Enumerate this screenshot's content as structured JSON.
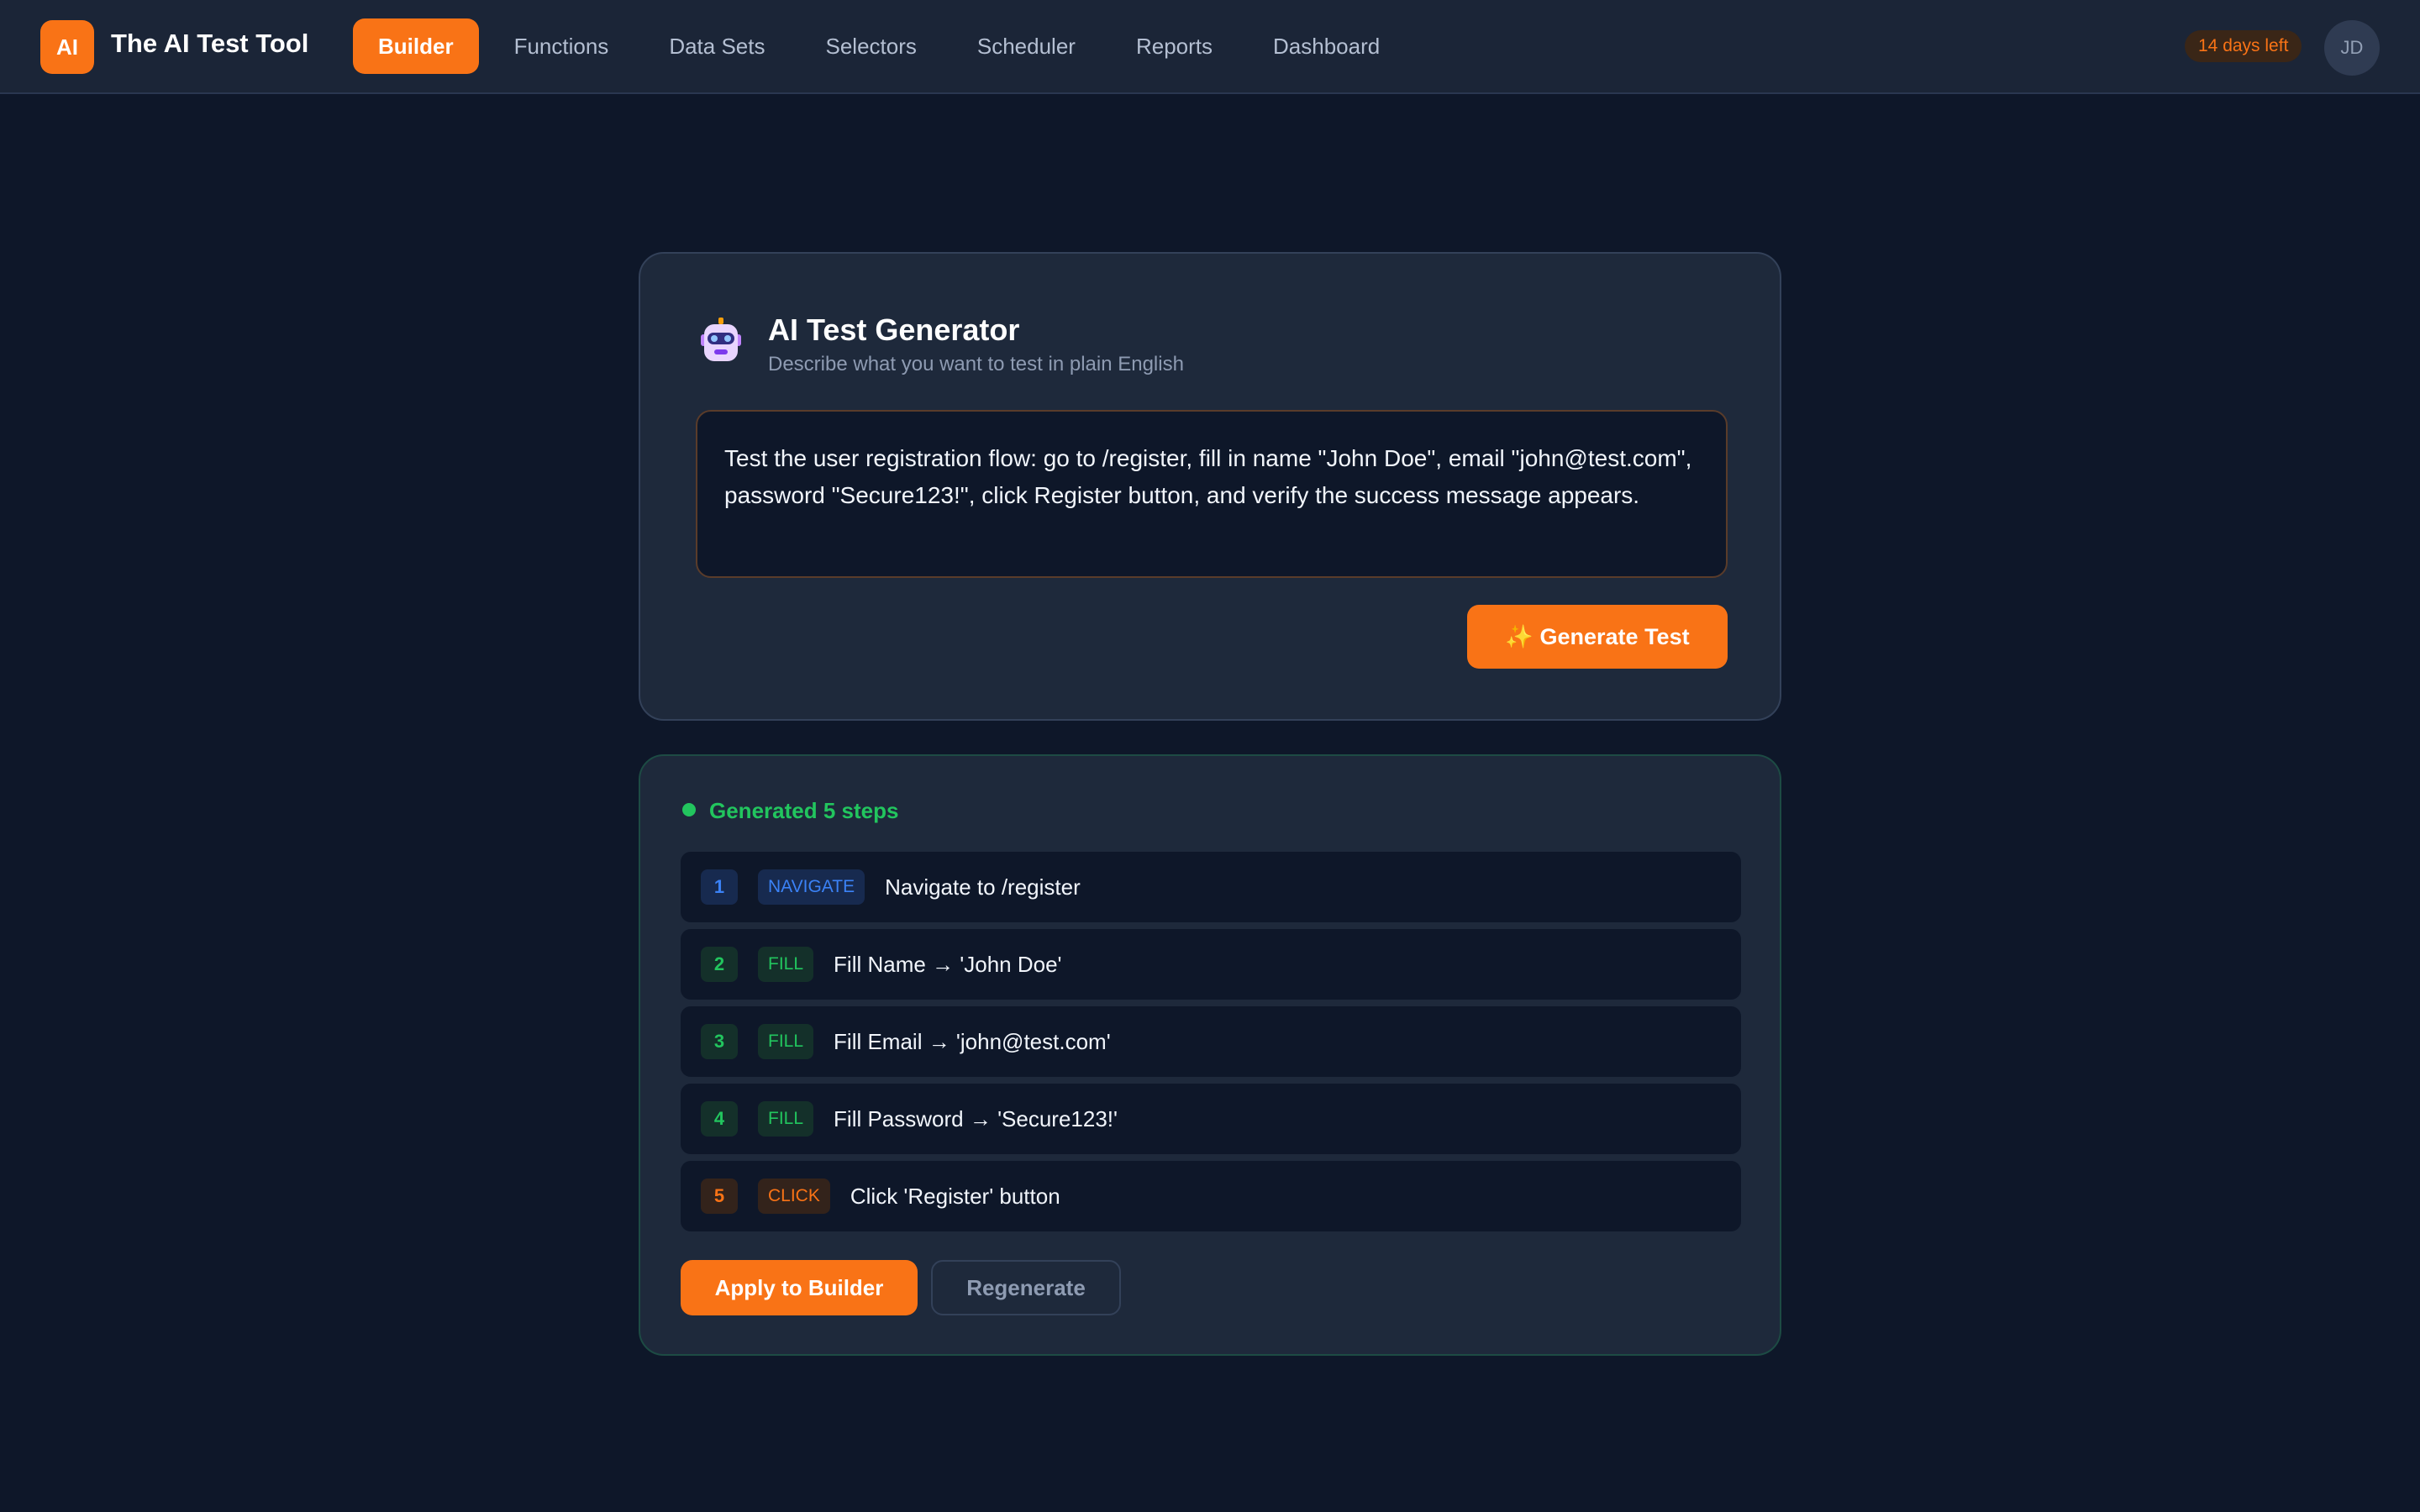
{
  "header": {
    "logo_text": "AI",
    "app_title": "The AI Test Tool",
    "nav": [
      {
        "label": "Builder",
        "active": true
      },
      {
        "label": "Functions"
      },
      {
        "label": "Data Sets"
      },
      {
        "label": "Selectors"
      },
      {
        "label": "Scheduler"
      },
      {
        "label": "Reports"
      },
      {
        "label": "Dashboard"
      }
    ],
    "trial_badge": "14 days left",
    "avatar_initials": "JD"
  },
  "generator": {
    "icon": "robot-icon",
    "title": "AI Test Generator",
    "subtitle": "Describe what you want to test in plain English",
    "prompt_value": "Test the user registration flow: go to /register, fill in name \"John Doe\", email \"john@test.com\", password \"Secure123!\", click Register button, and verify the success message appears.",
    "generate_button": "✨ Generate Test"
  },
  "result": {
    "status": "Generated 5 steps",
    "steps": [
      {
        "num": "1",
        "type": "NAVIGATE",
        "text": "Navigate to /register"
      },
      {
        "num": "2",
        "type": "FILL",
        "text": "Fill Name → 'John Doe'"
      },
      {
        "num": "3",
        "type": "FILL",
        "text": "Fill Email → 'john@test.com'"
      },
      {
        "num": "4",
        "type": "FILL",
        "text": "Fill Password → 'Secure123!'"
      },
      {
        "num": "5",
        "type": "CLICK",
        "text": "Click 'Register' button"
      }
    ],
    "apply_button": "Apply to Builder",
    "regenerate_button": "Regenerate"
  },
  "colors": {
    "accent": "#f97316",
    "success": "#22c55e",
    "navigate": "#3b82f6",
    "background": "#0e1729",
    "panel": "#1e293b"
  }
}
